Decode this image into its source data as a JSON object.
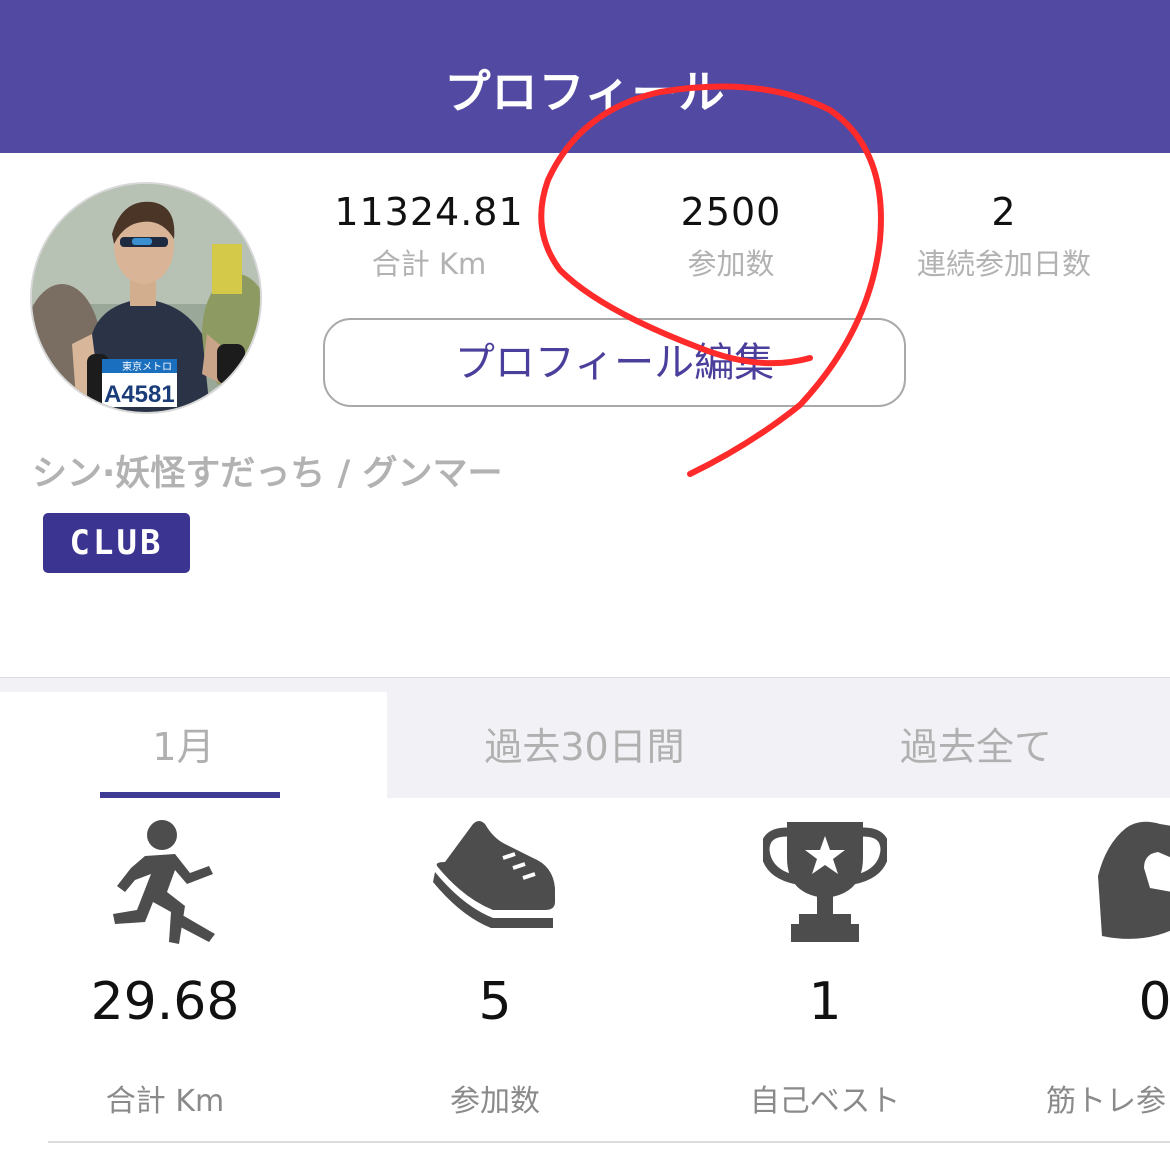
{
  "header": {
    "title": "プロフィール"
  },
  "profile": {
    "stats": [
      {
        "value": "11324.81",
        "label": "合計 Km"
      },
      {
        "value": "2500",
        "label": "参加数"
      },
      {
        "value": "2",
        "label": "連続参加日数"
      }
    ],
    "edit_button_label": "プロフィール編集",
    "username": "シン·妖怪すだっち / グンマー",
    "badge": "CLUB",
    "bib_brand": "東京メトロ",
    "bib_number": "A4581"
  },
  "tabs": [
    {
      "label": "1月",
      "active": true
    },
    {
      "label": "過去30日間",
      "active": false
    },
    {
      "label": "過去全て",
      "active": false
    }
  ],
  "month_stats": [
    {
      "icon": "running-person-icon",
      "value": "29.68",
      "label": "合計 Km"
    },
    {
      "icon": "sneaker-icon",
      "value": "5",
      "label": "参加数"
    },
    {
      "icon": "trophy-icon",
      "value": "1",
      "label": "自己ベスト"
    },
    {
      "icon": "muscle-arm-icon",
      "value": "0",
      "label": "筋トレ参"
    }
  ],
  "colors": {
    "header_bg": "#5249a2",
    "accent": "#3f3a93",
    "annotation": "#ff2a2a"
  }
}
